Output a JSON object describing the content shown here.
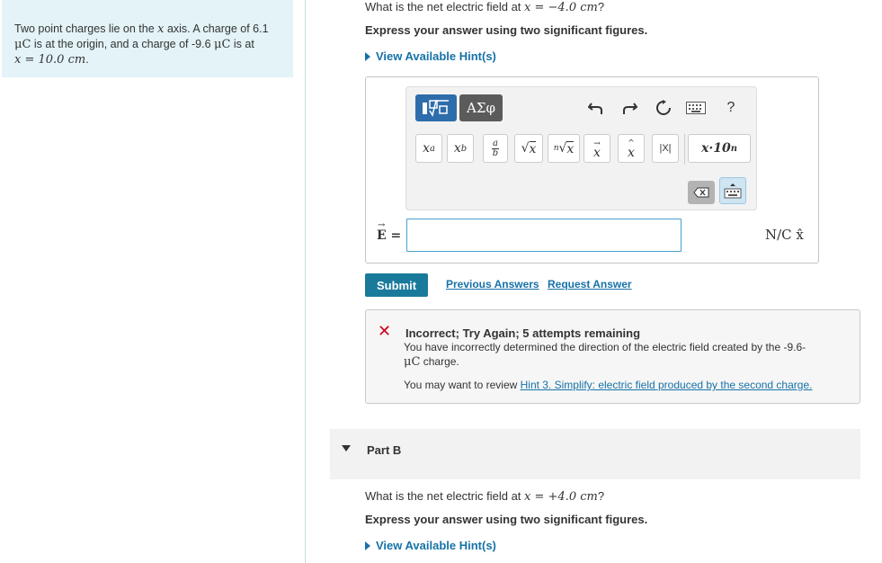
{
  "problem": {
    "text_1": "Two point charges lie on the ",
    "var_x": "x",
    "text_2": " axis. A charge of 6.1",
    "unit_uc1": "μC",
    "text_3": " is at the origin, and a charge of -9.6 ",
    "unit_uc2": "μC",
    "text_4": " is at",
    "position": "x = 10.0 cm",
    "text_5": "."
  },
  "part_a": {
    "question_prefix": "What is the net electric field at ",
    "question_value": "x = −4.0 cm",
    "question_suffix": "?",
    "instruction": "Express your answer using two significant figures.",
    "hint_label": "View Available Hint(s)",
    "toolbar": {
      "greek_label": "ΑΣφ",
      "help_label": "?",
      "keys": [
        "xᵃ",
        "x_b",
        "a/b",
        "√x",
        "ⁿ√x",
        "x⃗",
        "x̂",
        "|X|",
        "x·10ⁿ"
      ]
    },
    "input_label": "E =",
    "input_value": "",
    "unit": "N/C x̂",
    "submit_label": "Submit",
    "previous_answers_label": "Previous Answers",
    "request_answer_label": "Request Answer"
  },
  "feedback": {
    "status_icon": "x-icon",
    "status_color": "#d0021b",
    "title": "Incorrect; Try Again; 5 attempts remaining",
    "message_1": "You have incorrectly determined the direction of the electric field created by the -9.6-",
    "message_unit": "μC",
    "message_2": " charge.",
    "review_prefix": "You may want to review ",
    "review_link": "Hint 3. Simplify: electric field produced by the second charge."
  },
  "part_b": {
    "label": "Part B",
    "question_prefix": "What is the net electric field at ",
    "question_value": "x = +4.0 cm",
    "question_suffix": "?",
    "instruction": "Express your answer using two significant figures.",
    "hint_label": "View Available Hint(s)"
  },
  "colors": {
    "accent": "#1a7a9c",
    "link": "#1672a8",
    "problem_bg": "#e3f3f8"
  }
}
